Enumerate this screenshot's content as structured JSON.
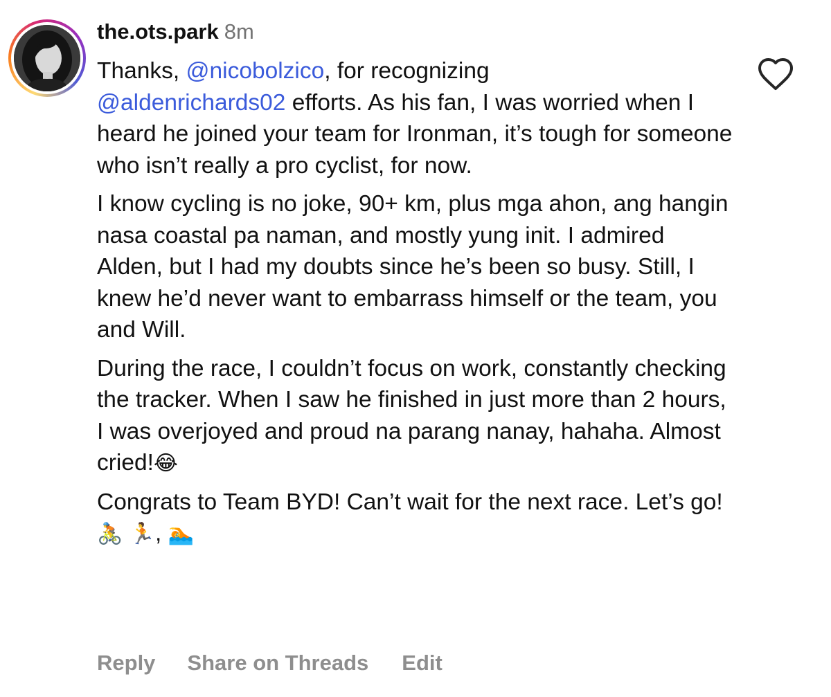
{
  "comment": {
    "username": "the.ots.park",
    "timestamp": "8m",
    "like_icon": "heart-outline-icon",
    "paragraphs": {
      "p1_a": "Thanks, ",
      "p1_mention1": "@nicobolzico",
      "p1_b": ", for recognizing",
      "p1_mention2": "@aldenrichards02",
      "p1_c": " efforts. As his fan, I was worried when I heard he joined your team for Ironman, it’s tough for someone who isn’t really a pro cyclist, for now.",
      "p2": "I know cycling is no joke, 90+ km, plus mga ahon, ang hangin nasa coastal pa naman, and mostly yung init. I admired Alden, but I had my doubts since he’s been so busy. Still, I knew he’d never want to embarrass himself or the team, you and Will.",
      "p3_a": "During the race, I couldn’t focus on work, constantly checking the tracker. When I saw he finished in just more than 2 hours, I was overjoyed and proud na parang nanay, hahaha. Almost cried!",
      "p3_emoji": "😂",
      "p4_a": "Congrats to Team BYD! Can’t wait for the next race. Let’s go! ",
      "p4_emoji1": "🚴",
      "p4_emoji2": "🏃",
      "p4_sep": ", ",
      "p4_emoji3": "🏊"
    }
  },
  "actions": {
    "reply": "Reply",
    "share": "Share on Threads",
    "edit": "Edit"
  },
  "colors": {
    "mention": "#3b5bdb",
    "muted": "#8e8e8e",
    "timestamp": "#737373"
  }
}
